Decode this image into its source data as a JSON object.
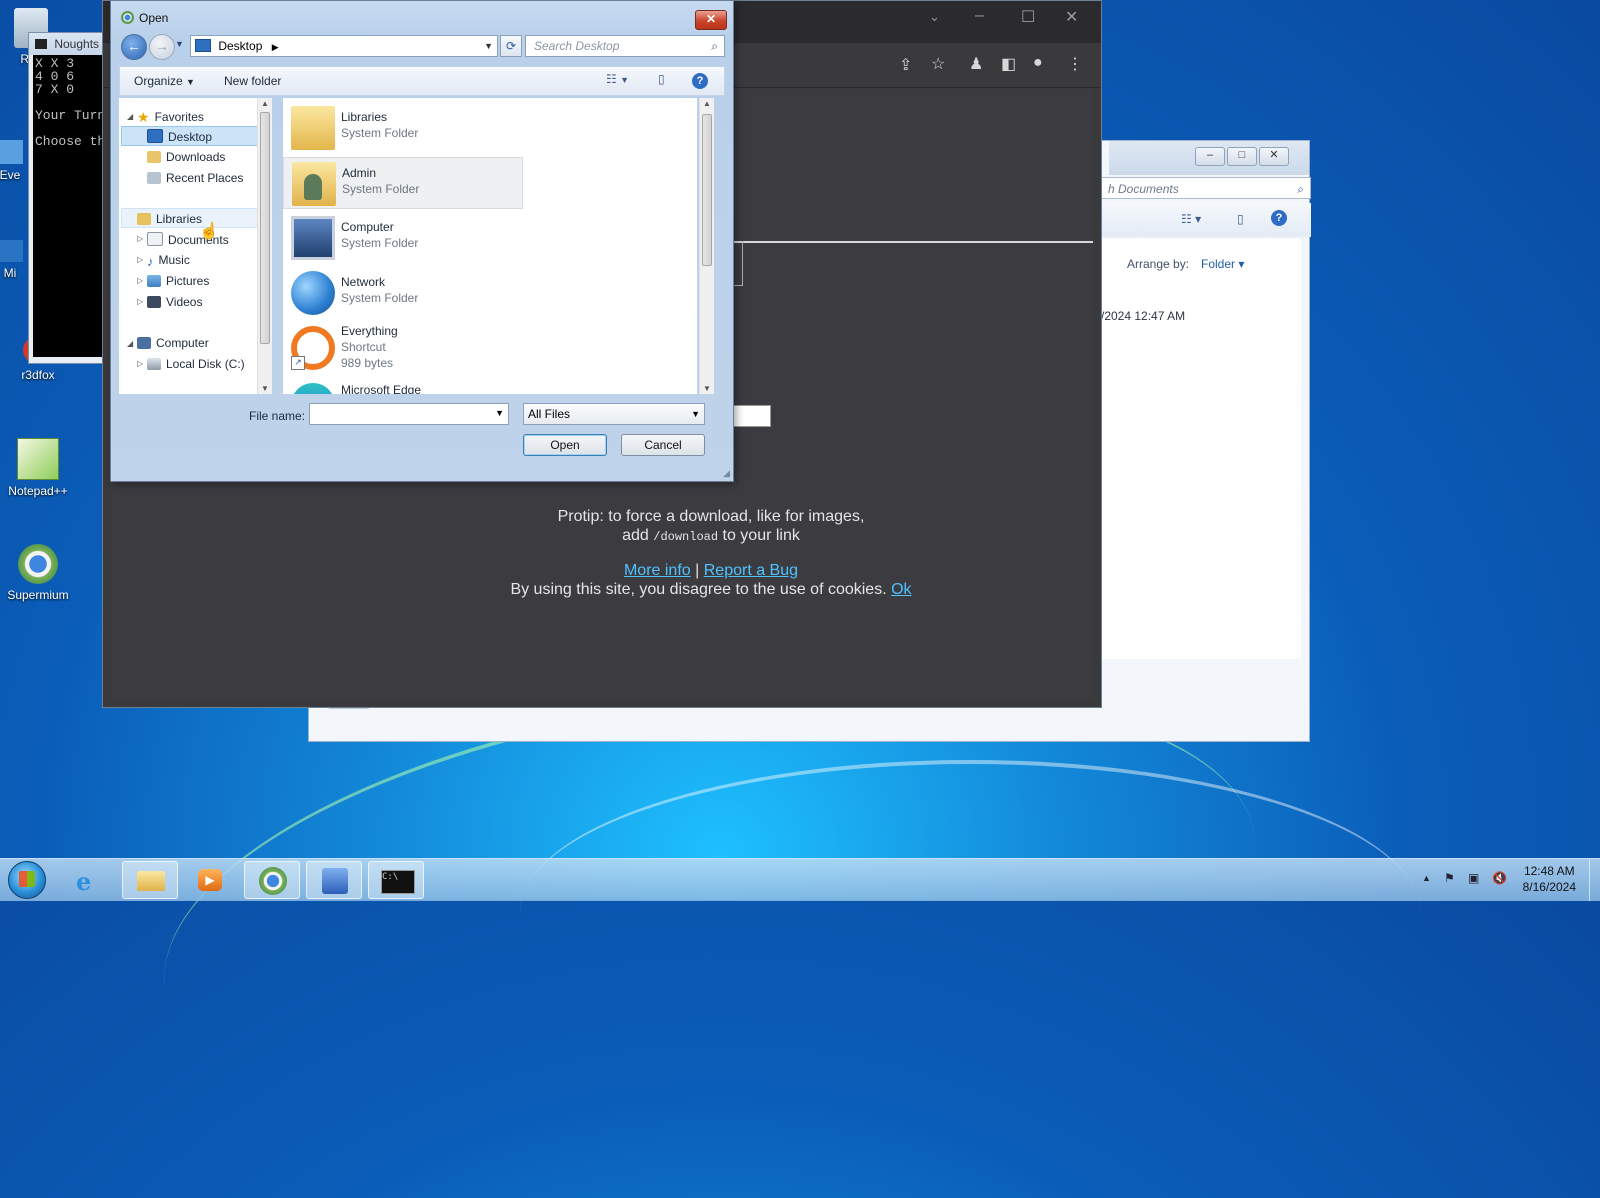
{
  "desktop": {
    "icons": [
      {
        "label": "Rec"
      },
      {
        "label": "Eve"
      },
      {
        "label": "Mi"
      },
      {
        "label": "r3dfox"
      },
      {
        "label": "Notepad++"
      },
      {
        "label": "Supermium"
      }
    ]
  },
  "console": {
    "title": "Noughts",
    "lines": "X X 3\n4 0 6\n7 X 0\n\nYour Turn\n\nChoose th"
  },
  "explorer": {
    "search_placeholder": "h Documents",
    "arrange_label": "Arrange by:",
    "arrange_value": "Folder",
    "date_text": "/2024 12:47 AM"
  },
  "browser": {
    "protip_line1": "Protip: to force a download, like for images,",
    "protip_add": "add",
    "protip_code": "/download",
    "protip_rest": "to your link",
    "more_info": "More info",
    "separator": "|",
    "report_bug": "Report a Bug",
    "cookie_text": "By using this site, you disagree to the use of cookies.",
    "ok_link": "Ok"
  },
  "dialog": {
    "title": "Open",
    "close_glyph": "✕",
    "address": "Desktop",
    "search_placeholder": "Search Desktop",
    "organize": "Organize",
    "new_folder": "New folder",
    "nav": {
      "favorites": "Favorites",
      "desktop": "Desktop",
      "downloads": "Downloads",
      "recent_places": "Recent Places",
      "libraries": "Libraries",
      "documents": "Documents",
      "music": "Music",
      "pictures": "Pictures",
      "videos": "Videos",
      "computer": "Computer",
      "local_disk": "Local Disk (C:)"
    },
    "files": [
      {
        "name": "Libraries",
        "type": "System Folder"
      },
      {
        "name": "Admin",
        "type": "System Folder"
      },
      {
        "name": "Computer",
        "type": "System Folder"
      },
      {
        "name": "Network",
        "type": "System Folder"
      },
      {
        "name": "Everything",
        "type": "Shortcut",
        "size": "989 bytes"
      },
      {
        "name": "Microsoft Edge"
      }
    ],
    "file_name_label": "File name:",
    "file_name_value": "",
    "file_type": "All Files",
    "open_label": "Open",
    "cancel_label": "Cancel"
  },
  "taskbar": {
    "time": "12:48 AM",
    "date": "8/16/2024"
  }
}
